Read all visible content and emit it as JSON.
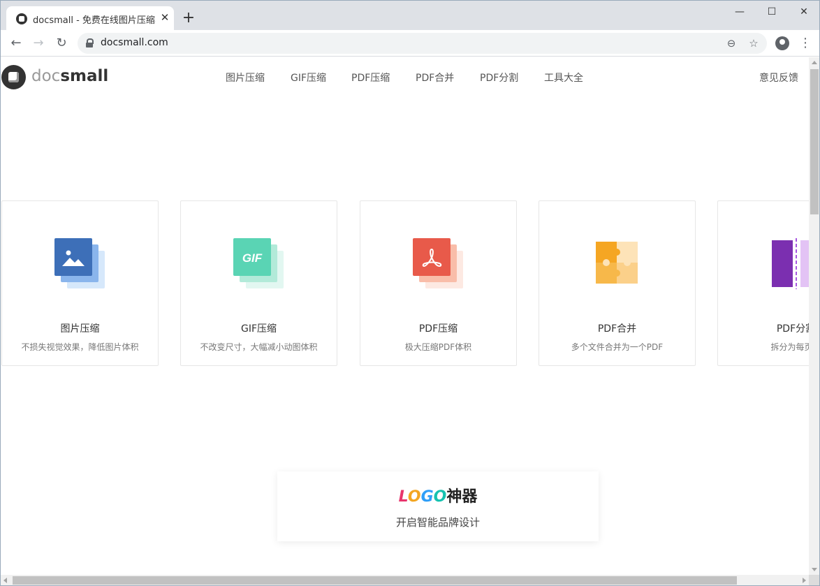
{
  "browser": {
    "tab_title": "docsmall - 免费在线图片压缩、G",
    "tab_close": "✕",
    "new_tab": "+",
    "url": "docsmall.com",
    "controls": {
      "minimize": "—",
      "maximize": "☐",
      "close": "✕"
    },
    "nav": {
      "back": "←",
      "forward": "→",
      "reload": "↻"
    },
    "omni_icons": {
      "zoom": "⊖",
      "star": "☆"
    },
    "menu": "⋮"
  },
  "site": {
    "logo": {
      "doc": "doc",
      "small": "small"
    },
    "nav_items": [
      "图片压缩",
      "GIF压缩",
      "PDF压缩",
      "PDF合并",
      "PDF分割",
      "工具大全"
    ],
    "feedback": "意见反馈"
  },
  "cards": [
    {
      "title": "图片压缩",
      "desc": "不损失视觉效果，降低图片体积",
      "icon": "image-stack-icon"
    },
    {
      "title": "GIF压缩",
      "desc": "不改变尺寸，大幅减小动图体积",
      "icon": "gif-stack-icon",
      "icon_text": "GIF"
    },
    {
      "title": "PDF压缩",
      "desc": "极大压缩PDF体积",
      "icon": "pdf-stack-icon"
    },
    {
      "title": "PDF合并",
      "desc": "多个文件合并为一个PDF",
      "icon": "puzzle-icon"
    },
    {
      "title": "PDF分割",
      "desc": "拆分为每页一",
      "icon": "split-icon"
    }
  ],
  "promo": {
    "logo_letters": [
      "L",
      "O",
      "G",
      "O"
    ],
    "logo_rest": "神器",
    "subtitle": "开启智能品牌设计"
  },
  "colors": {
    "image_blue": "#3d6fb8",
    "gif_teal": "#5ad4b4",
    "pdf_red": "#e85a4a",
    "puzzle_orange": "#f5a623",
    "split_purple": "#7b2fb0"
  }
}
